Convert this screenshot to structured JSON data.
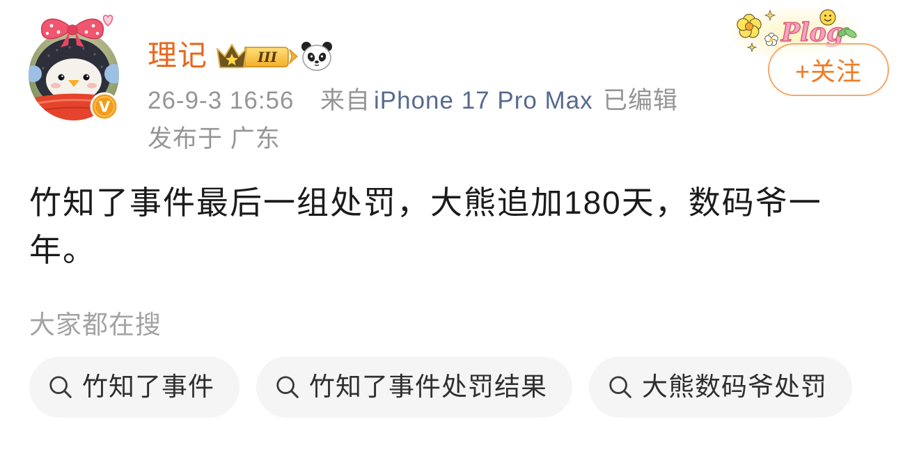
{
  "post": {
    "author": {
      "name": "理记",
      "avatar": "penguin-plush-avatar",
      "verified_badge_letter": "V",
      "level_badge_text": "III",
      "badge_icons": [
        "crown-level-badge-icon",
        "panda-icon"
      ]
    },
    "follow_button": "+关注",
    "decoration": {
      "sticker_text": "Plog",
      "icons": [
        "flower-icon",
        "sparkle-icon",
        "smiley-icon",
        "leaf-icon"
      ]
    },
    "meta": {
      "time": "26-9-3 16:56",
      "source_prefix": "来自",
      "source_device": "iPhone 17 Pro Max",
      "edited": "已编辑",
      "location": "发布于 广东"
    },
    "content": "竹知了事件最后一组处罚，大熊追加180天，数码爷一年。"
  },
  "trending": {
    "title": "大家都在搜",
    "searches": [
      {
        "label": "竹知了事件",
        "icon": "search-icon"
      },
      {
        "label": "竹知了事件处罚结果",
        "icon": "search-icon"
      },
      {
        "label": "大熊数码爷处罚",
        "icon": "search-icon"
      }
    ]
  },
  "colors": {
    "username": "#e8671c",
    "source_link": "#56698f",
    "follow_accent": "#f07a21",
    "follow_border": "#f5a868",
    "meta_text": "#959595",
    "content_text": "#1b1b1b",
    "chip_background": "#f5f5f5"
  }
}
